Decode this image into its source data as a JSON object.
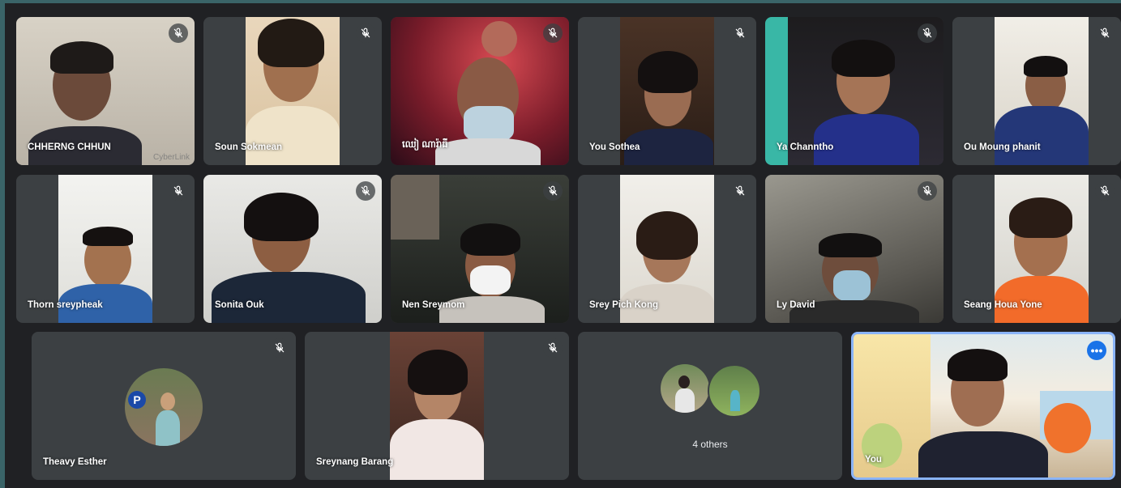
{
  "participants": [
    {
      "name": "CHHERNG CHHUN",
      "muted": true,
      "watermark": "CyberLink"
    },
    {
      "name": "Soun Sokmean",
      "muted": true
    },
    {
      "name": "ឈៀ ណារ៉ាធី",
      "muted": true
    },
    {
      "name": "You Sothea",
      "muted": true
    },
    {
      "name": "Ya Channtho",
      "muted": true
    },
    {
      "name": "Ou Moung phanit",
      "muted": true
    },
    {
      "name": "Thorn sreypheak",
      "muted": true
    },
    {
      "name": "Sonita Ouk",
      "muted": true
    },
    {
      "name": "Nen Sreymom",
      "muted": true
    },
    {
      "name": "Srey Pich Kong",
      "muted": true
    },
    {
      "name": "Ly David",
      "muted": true
    },
    {
      "name": "Seang Houa Yone",
      "muted": true
    },
    {
      "name": "Theavy Esther",
      "muted": true
    },
    {
      "name": "Sreynang Barang",
      "muted": true
    }
  ],
  "others": {
    "label": "4 others"
  },
  "self": {
    "name": "You",
    "more_label": "•••"
  },
  "icons": {
    "mute": "mic-off-icon",
    "more": "more-options-icon"
  },
  "colors": {
    "stage": "#202124",
    "tile": "#3c4043",
    "accent": "#1a73e8",
    "frame": "#3a6468"
  }
}
